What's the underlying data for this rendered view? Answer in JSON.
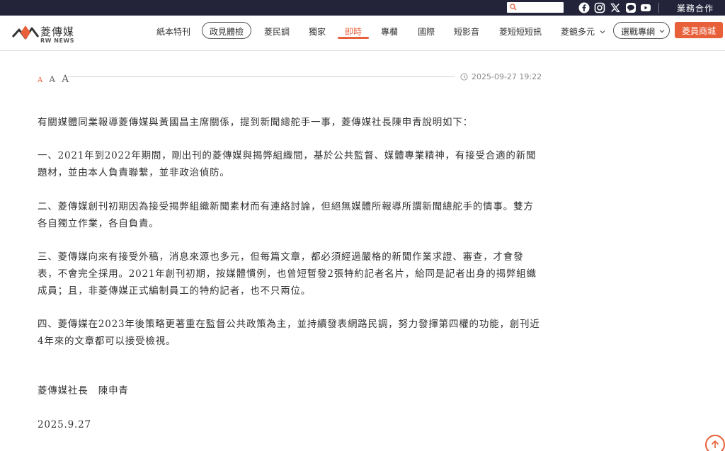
{
  "topbar": {
    "search_placeholder": "",
    "social_icons": [
      "facebook-icon",
      "instagram-icon",
      "x-icon",
      "line-icon",
      "youtube-icon"
    ],
    "business_label": "業務合作"
  },
  "brand": {
    "name": "菱傳媒",
    "sub": "RW NEWS",
    "accent": "#e8603a"
  },
  "nav": {
    "items": [
      "紙本特刊",
      "政見體檢",
      "菱民調",
      "獨家",
      "即時",
      "專欄",
      "國際",
      "短影音",
      "菱短短短訊",
      "菱鏡多元",
      "選戰專網"
    ],
    "active": "即時",
    "shop_label": "菱員商城"
  },
  "article": {
    "font_size_labels": [
      "A",
      "A",
      "A"
    ],
    "datetime": "2025-09-27 19:22",
    "paragraphs": [
      "有關媒體同業報導菱傳媒與黃國昌主席關係，提到新聞總舵手一事，菱傳媒社長陳申青說明如下：",
      "一、2021年到2022年期間，剛出刊的菱傳媒與揭弊組織間，基於公共監督、媒體專業精神，有接受合適的新聞題材，並由本人負責聯繫，並非政治偵防。",
      "二、菱傳媒創刊初期因為接受揭弊組織新聞素材而有連絡討論，但絕無媒體所報導所謂新聞總舵手的情事。雙方各自獨立作業，各自負責。",
      "三、菱傳媒向來有接受外稿，消息來源也多元，但每篇文章，都必須經過嚴格的新聞作業求證、審查，才會發表，不會完全採用。2021年創刊初期，按媒體慣例，也曾短暫發2張特約記者名片，給同是記者出身的揭弊組織成員；且，非菱傳媒正式編制員工的特約記者，也不只兩位。",
      "四、菱傳媒在2023年後策略更著重在監督公共政策為主，並持續發表網路民調，努力發揮第四權的功能，創刊近4年來的文章都可以接受檢視。",
      "菱傳媒社長　陳申青",
      "2025.9.27"
    ]
  }
}
